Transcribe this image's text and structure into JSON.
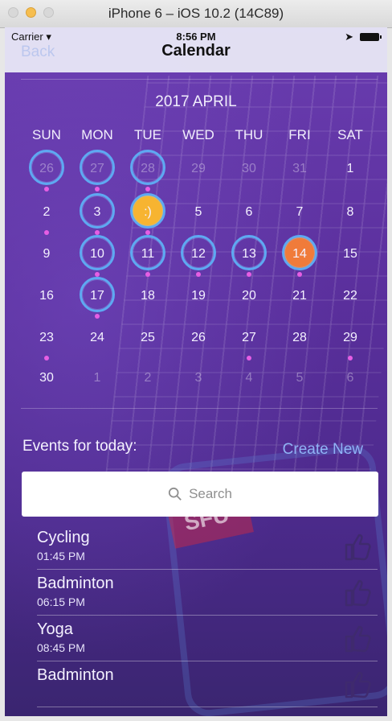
{
  "window": {
    "title": "iPhone 6 – iOS 10.2 (14C89)"
  },
  "status_bar": {
    "carrier": "Carrier",
    "time": "8:56 PM"
  },
  "nav": {
    "back_label": "Back",
    "title": "Calendar"
  },
  "calendar": {
    "month_label": "2017 APRIL",
    "weekdays": [
      "SUN",
      "MON",
      "TUE",
      "WED",
      "THU",
      "FRI",
      "SAT"
    ],
    "weeks": [
      [
        {
          "d": "26",
          "dim": true,
          "ring": true,
          "dot": true
        },
        {
          "d": "27",
          "dim": true,
          "ring": true,
          "dot": true
        },
        {
          "d": "28",
          "dim": true,
          "ring": true,
          "dot": true
        },
        {
          "d": "29",
          "dim": true
        },
        {
          "d": "30",
          "dim": true
        },
        {
          "d": "31",
          "dim": true
        },
        {
          "d": "1"
        }
      ],
      [
        {
          "d": "2",
          "dot": true
        },
        {
          "d": "3",
          "ring": true,
          "dot": true
        },
        {
          "d": ":)",
          "ring": true,
          "smile": true,
          "dot": true
        },
        {
          "d": "5"
        },
        {
          "d": "6"
        },
        {
          "d": "7"
        },
        {
          "d": "8"
        }
      ],
      [
        {
          "d": "9"
        },
        {
          "d": "10",
          "ring": true,
          "dot": true
        },
        {
          "d": "11",
          "ring": true,
          "dot": true
        },
        {
          "d": "12",
          "ring": true,
          "dot": true
        },
        {
          "d": "13",
          "ring": true,
          "dot": true
        },
        {
          "d": "14",
          "ring": true,
          "today": true,
          "dot": true
        },
        {
          "d": "15"
        }
      ],
      [
        {
          "d": "16"
        },
        {
          "d": "17",
          "ring": true,
          "dot": true
        },
        {
          "d": "18"
        },
        {
          "d": "19"
        },
        {
          "d": "20"
        },
        {
          "d": "21"
        },
        {
          "d": "22"
        }
      ],
      [
        {
          "d": "23",
          "dot": true
        },
        {
          "d": "24"
        },
        {
          "d": "25"
        },
        {
          "d": "26"
        },
        {
          "d": "27",
          "dot": true
        },
        {
          "d": "28"
        },
        {
          "d": "29",
          "dot": true
        }
      ],
      [
        {
          "d": "30"
        },
        {
          "d": "1",
          "dim": true
        },
        {
          "d": "2",
          "dim": true
        },
        {
          "d": "3",
          "dim": true
        },
        {
          "d": "4",
          "dim": true
        },
        {
          "d": "5",
          "dim": true
        },
        {
          "d": "6",
          "dim": true
        }
      ]
    ]
  },
  "events_section": {
    "label": "Events for today:",
    "create_label": "Create New"
  },
  "search": {
    "placeholder": "Search"
  },
  "events": [
    {
      "name": "Cycling",
      "time": "01:45 PM"
    },
    {
      "name": "Badminton",
      "time": "06:15 PM"
    },
    {
      "name": "Yoga",
      "time": "08:45 PM"
    },
    {
      "name": "Badminton",
      "time": ""
    }
  ],
  "icons": {
    "search": "search-icon",
    "like": "thumbs-up-icon",
    "location": "location-arrow-icon",
    "wifi": "wifi-icon",
    "battery": "battery-icon"
  },
  "colors": {
    "today": "#f07b3a",
    "smile": "#f7b431",
    "ring": "#5ea9f2",
    "event_dot": "#e65ee4",
    "link": "#8fb3f5"
  }
}
